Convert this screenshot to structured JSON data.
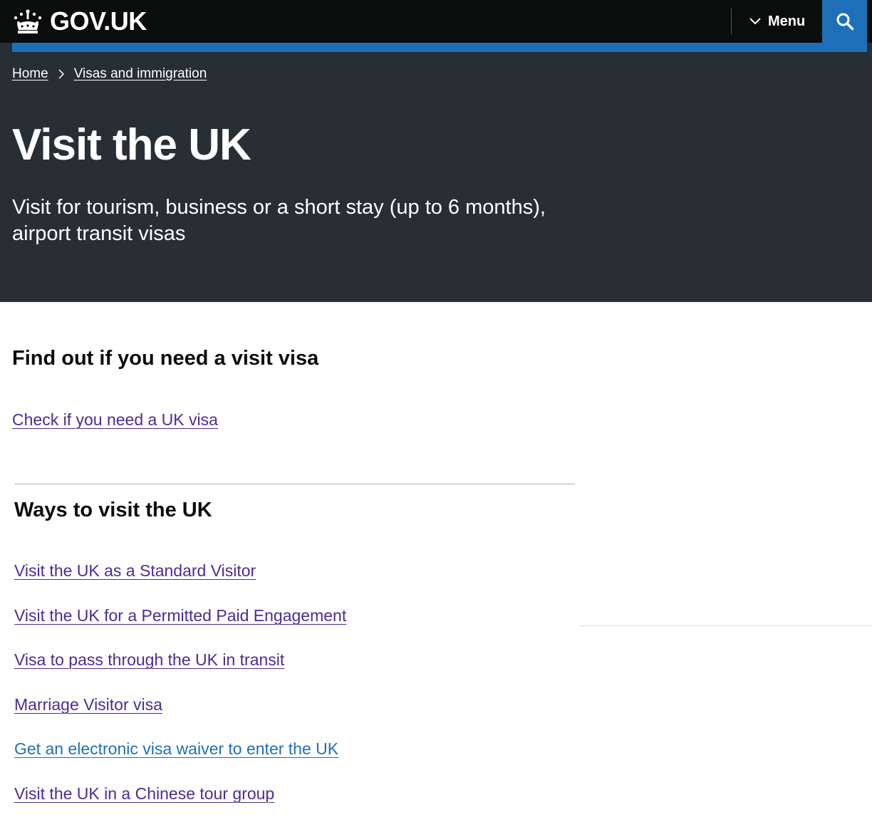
{
  "header": {
    "logo_text": "GOV.UK",
    "menu_label": "Menu",
    "search_icon": "search-icon",
    "brand_color": "#1d70b8"
  },
  "breadcrumb": {
    "items": [
      "Home",
      "Visas and immigration"
    ]
  },
  "hero": {
    "title": "Visit the UK",
    "description": "Visit for tourism, business or a short stay (up to 6 months), airport transit visas"
  },
  "find_out": {
    "heading": "Find out if you need a visit visa",
    "link": "Check if you need a UK visa"
  },
  "ways": {
    "heading": "Ways to visit the UK",
    "links": [
      "Visit the UK as a Standard Visitor",
      "Visit the UK for a Permitted Paid Engagement",
      "Visa to pass through the UK in transit",
      "Marriage Visitor visa",
      "Get an electronic visa waiver to enter the UK",
      "Visit the UK in a Chinese tour group"
    ]
  },
  "colors": {
    "header_bg": "#0b0c0c",
    "hero_bg": "#272f35",
    "visited_link": "#4c2c92",
    "unvisited_link": "#1d70b8"
  }
}
